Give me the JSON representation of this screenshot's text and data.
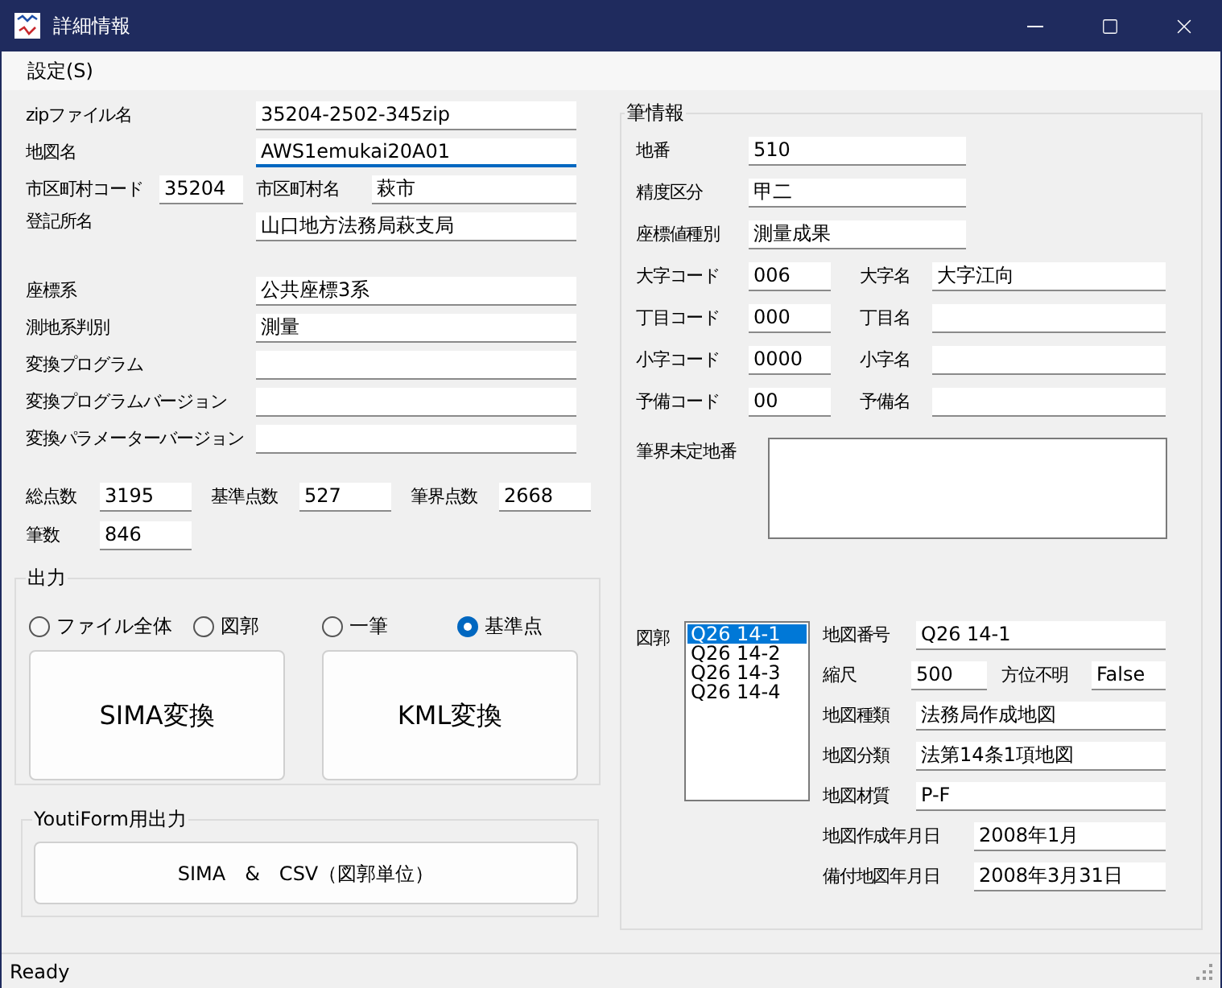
{
  "window": {
    "title": "詳細情報"
  },
  "menu": [
    "設定(S)"
  ],
  "file_fields": [
    {
      "label": "zipファイル名",
      "value": "35204-2502-345zip",
      "focused": false
    },
    {
      "label": "地図名",
      "value": "AWS1emukai20A01",
      "focused": true
    }
  ],
  "municipality": {
    "code_label": "市区町村コード",
    "code": "35204",
    "name_label": "市区町村名",
    "name": "萩市"
  },
  "registry": {
    "label": "登記所名",
    "value": "山口地方法務局萩支局"
  },
  "coordinate_fields": [
    {
      "label": "座標系",
      "value": "公共座標3系"
    },
    {
      "label": "測地系判別",
      "value": "測量"
    },
    {
      "label": "変換プログラム"
    },
    {
      "label": "変換プログラムバージョン"
    },
    {
      "label": "変換パラメーターバージョン"
    }
  ],
  "counts": [
    {
      "label": "総点数",
      "value": "3195"
    },
    {
      "label": "基準点数",
      "value": "527"
    },
    {
      "label": "筆界点数",
      "value": "2668"
    },
    {
      "label": "筆数",
      "value": "846"
    }
  ],
  "output": {
    "title": "出力",
    "options": [
      {
        "label": "ファイル全体",
        "selected": false
      },
      {
        "label": "図郭",
        "selected": false
      },
      {
        "label": "一筆",
        "selected": false
      },
      {
        "label": "基準点",
        "selected": true
      }
    ],
    "buttons": [
      "SIMA変換",
      "KML変換"
    ]
  },
  "youtiform": {
    "title": "YoutiForm用出力",
    "button": "SIMA　&　CSV（図郭単位）"
  },
  "parcel": {
    "title": "筆情報",
    "fields": [
      {
        "label": "地番",
        "value": "510"
      },
      {
        "label": "精度区分",
        "value": "甲二"
      },
      {
        "label": "座標値種別",
        "value": "測量成果"
      }
    ],
    "code_rows": [
      {
        "code_label": "大字コード",
        "code": "006",
        "name_label": "大字名",
        "name": "大字江向"
      },
      {
        "code_label": "丁目コード",
        "code": "000",
        "name_label": "丁目名"
      },
      {
        "code_label": "小字コード",
        "code": "0000",
        "name_label": "小字名"
      },
      {
        "code_label": "予備コード",
        "code": "00",
        "name_label": "予備名"
      }
    ],
    "undetermined_label": "筆界未定地番"
  },
  "sheets": {
    "label": "図郭",
    "items": [
      {
        "text": "Q26 14-1",
        "selected": true
      },
      {
        "text": "Q26 14-2",
        "selected": false
      },
      {
        "text": "Q26 14-3",
        "selected": false
      },
      {
        "text": "Q26 14-4",
        "selected": false
      }
    ],
    "map_fields": [
      {
        "kind": "field",
        "label": "地図番号",
        "value": "Q26 14-1"
      },
      {
        "kind": "pair",
        "label": "縮尺",
        "value": "500",
        "label2": "方位不明",
        "value2": "False"
      },
      {
        "kind": "field",
        "label": "地図種類",
        "value": "法務局作成地図"
      },
      {
        "kind": "field",
        "label": "地図分類",
        "value": "法第14条1項地図"
      },
      {
        "kind": "field",
        "label": "地図材質",
        "value": "P-F"
      },
      {
        "kind": "date",
        "label": "地図作成年月日",
        "value": "2008年1月"
      },
      {
        "kind": "date",
        "label": "備付地図年月日",
        "value": "2008年3月31日"
      }
    ]
  },
  "status_bar": "Ready"
}
